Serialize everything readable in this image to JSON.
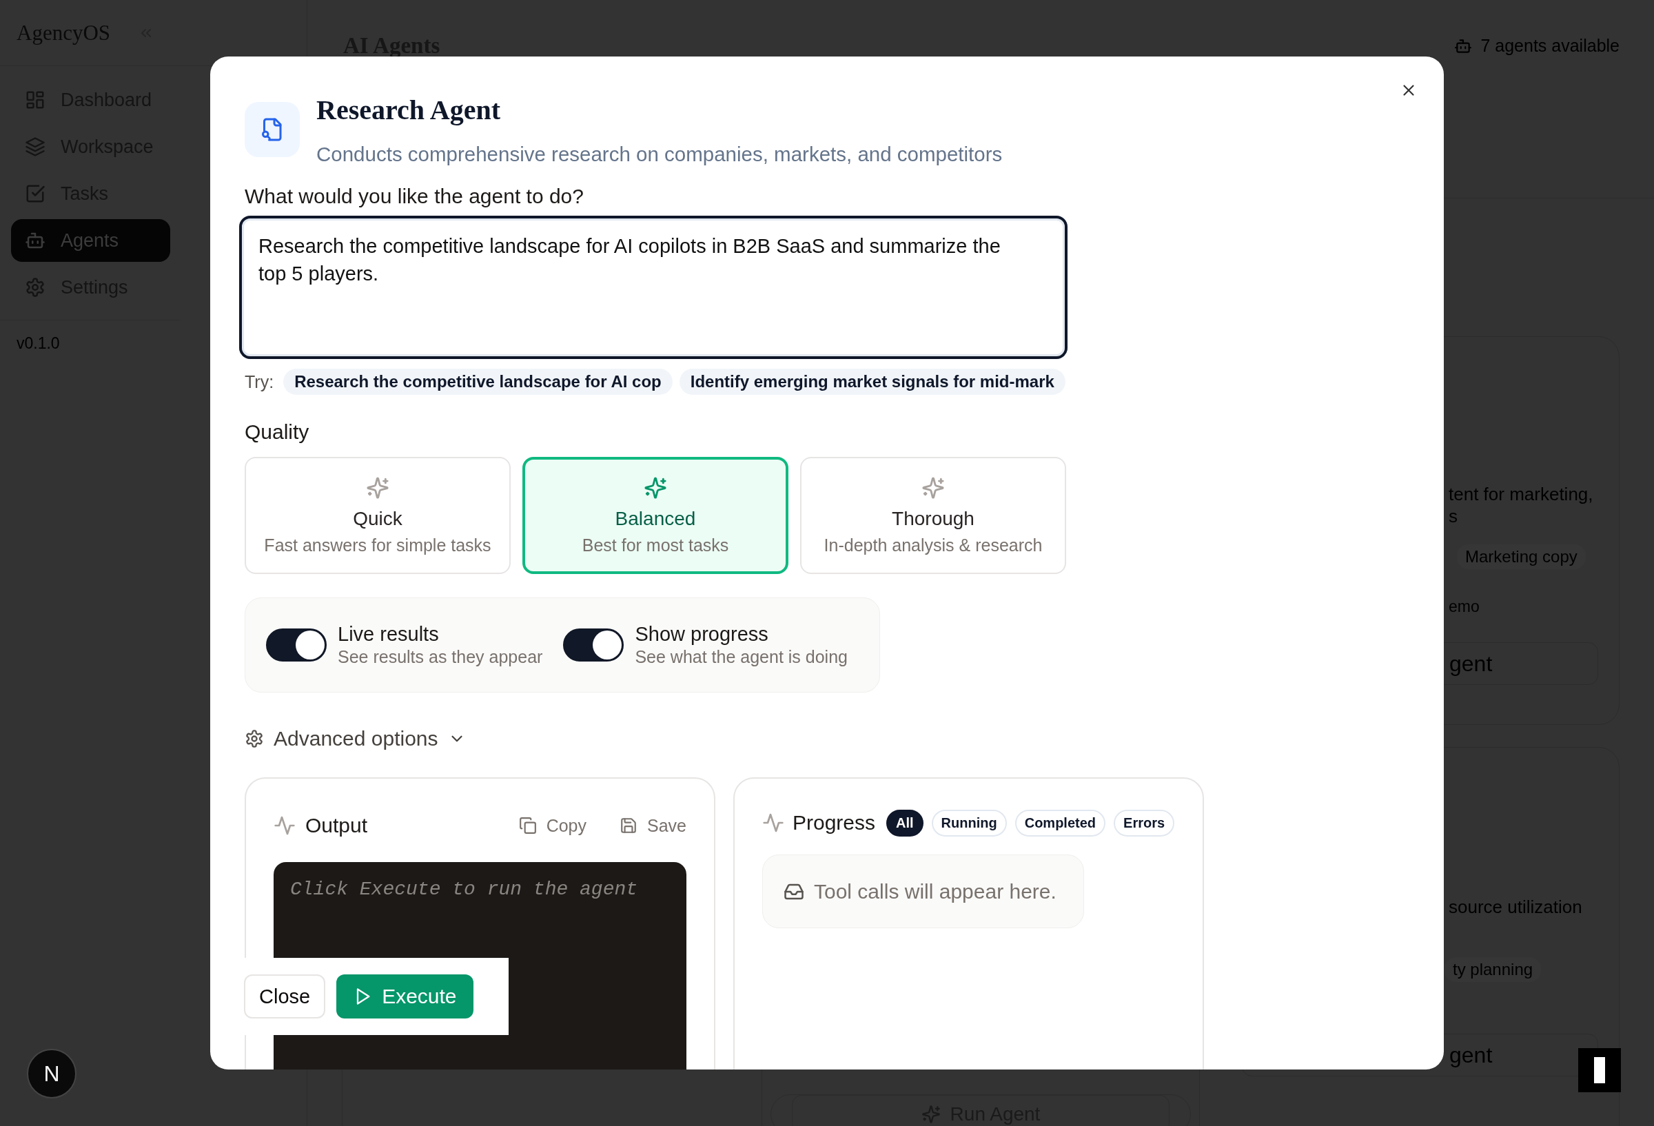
{
  "sidebar": {
    "logo": "AgencyOS",
    "items": [
      {
        "label": "Dashboard",
        "selected": false
      },
      {
        "label": "Workspace",
        "selected": false
      },
      {
        "label": "Tasks",
        "selected": false
      },
      {
        "label": "Agents",
        "selected": true
      },
      {
        "label": "Settings",
        "selected": false
      }
    ],
    "version": "v0.1.0"
  },
  "header": {
    "title": "AI Agents",
    "agents_count": "7 agents available"
  },
  "background_cards": [
    {
      "description": "tent for marketing,",
      "description_line_2": "s",
      "tag": "Marketing copy",
      "link": "emo",
      "button": "gent"
    },
    {
      "description": "source utilization",
      "tag": "ty planning",
      "button": "gent"
    }
  ],
  "run_agent_button": "Run Agent",
  "dev_badge": "N",
  "modal": {
    "title": "Research Agent",
    "description": "Conducts comprehensive research on companies, markets, and competitors",
    "prompt_label": "What would you like the agent to do?",
    "prompt_value": "Research the competitive landscape for AI copilots in B2B SaaS and summarize the top 5 players.",
    "try_label": "Try:",
    "suggestions": [
      "Research the competitive landscape for AI cop",
      "Identify emerging market signals for mid-mark"
    ],
    "quality_label": "Quality",
    "quality_options": [
      {
        "label": "Quick",
        "description": "Fast answers for simple tasks",
        "selected": false
      },
      {
        "label": "Balanced",
        "description": "Best for most tasks",
        "selected": true
      },
      {
        "label": "Thorough",
        "description": "In-depth analysis & research",
        "selected": false
      }
    ],
    "toggles": [
      {
        "label": "Live results",
        "description": "See results as they appear",
        "on": true
      },
      {
        "label": "Show progress",
        "description": "See what the agent is doing",
        "on": true
      }
    ],
    "advanced_options": {
      "label": "Advanced options",
      "expanded": false
    },
    "output": {
      "title": "Output",
      "copy": "Copy",
      "save": "Save",
      "placeholder": "Click Execute to run the agent"
    },
    "progress": {
      "title": "Progress",
      "filters": [
        {
          "label": "All",
          "selected": true
        },
        {
          "label": "Running",
          "selected": false
        },
        {
          "label": "Completed",
          "selected": false
        },
        {
          "label": "Errors",
          "selected": false
        }
      ],
      "empty": "Tool calls will appear here."
    },
    "footer": {
      "close": "Close",
      "execute": "Execute"
    }
  }
}
